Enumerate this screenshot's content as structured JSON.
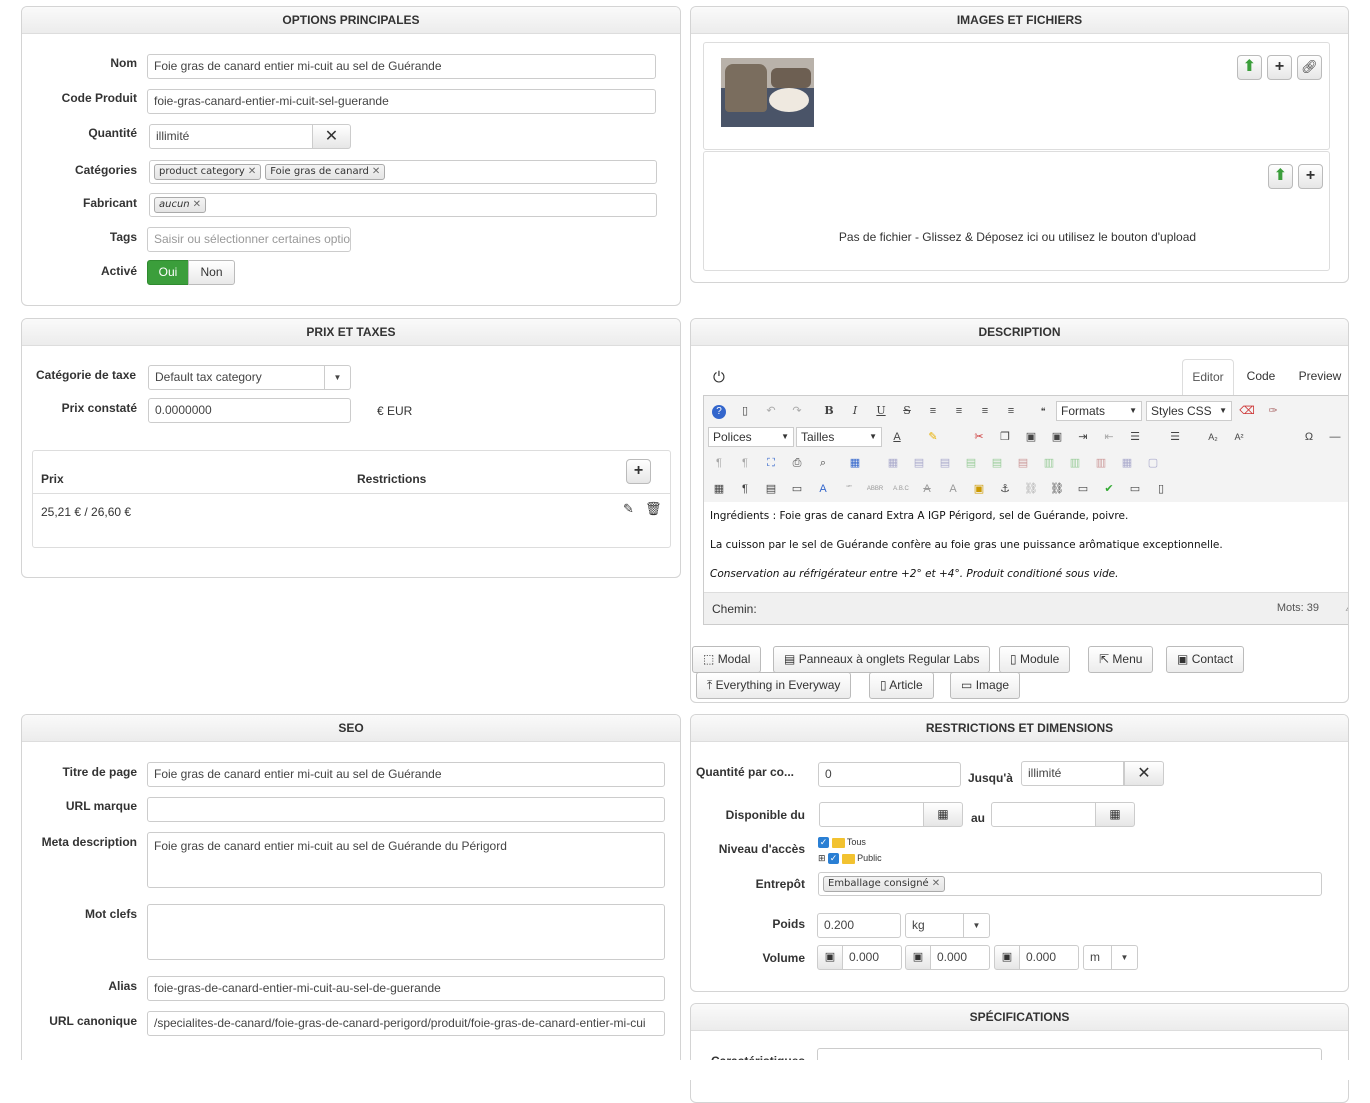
{
  "options": {
    "title": "OPTIONS PRINCIPALES",
    "nom_label": "Nom",
    "nom_value": "Foie gras de canard entier mi-cuit au sel de Guérande",
    "code_label": "Code Produit",
    "code_value": "foie-gras-canard-entier-mi-cuit-sel-guerande",
    "qty_label": "Quantité",
    "qty_value": "illimité",
    "cat_label": "Catégories",
    "categories": [
      "product category",
      "Foie gras de canard"
    ],
    "fab_label": "Fabricant",
    "fab_tag": "aucun",
    "tags_label": "Tags",
    "tags_placeholder": "Saisir ou sélectionner certaines optio",
    "active_label": "Activé",
    "yes": "Oui",
    "no": "Non"
  },
  "images": {
    "title": "IMAGES ET FICHIERS",
    "empty_text": "Pas de fichier - Glissez & Déposez ici ou utilisez le bouton d'upload"
  },
  "prix": {
    "title": "PRIX ET TAXES",
    "tax_label": "Catégorie de taxe",
    "tax_value": "Default tax category",
    "prix_label": "Prix constaté",
    "prix_value": "0.0000000",
    "currency": "€ EUR",
    "col_prix": "Prix",
    "col_restrictions": "Restrictions",
    "row_price": "25,21 € / 26,60 €"
  },
  "description": {
    "title": "DESCRIPTION",
    "tabs": [
      "Editor",
      "Code",
      "Preview"
    ],
    "formats": "Formats",
    "styles": "Styles CSS",
    "polices": "Polices",
    "tailles": "Tailles",
    "line1": "Ingrédients : Foie gras de canard Extra A IGP Périgord, sel de Guérande, poivre.",
    "line2": "La cuisson par le sel de Guérande confère au foie gras une puissance arômatique exceptionnelle.",
    "line3": "Conservation au réfrigérateur entre +2° et +4°. Produit conditioné sous vide.",
    "path": "Chemin:",
    "words": "Mots: 39",
    "buttons": [
      "Modal",
      "Panneaux à onglets Regular Labs",
      "Module",
      "Menu",
      "Contact",
      "Everything in Everyway",
      "Article",
      "Image"
    ]
  },
  "seo": {
    "title": "SEO",
    "page_title_label": "Titre de page",
    "page_title_value": "Foie gras de canard entier mi-cuit au sel de Guérande",
    "url_marque_label": "URL marque",
    "meta_label": "Meta description",
    "meta_value": "Foie gras de canard entier mi-cuit au sel de Guérande du Périgord",
    "keywords_label": "Mot clefs",
    "alias_label": "Alias",
    "alias_value": "foie-gras-de-canard-entier-mi-cuit-au-sel-de-guerande",
    "canon_label": "URL canonique",
    "canon_value": "/specialites-de-canard/foie-gras-de-canard-perigord/produit/foie-gras-de-canard-entier-mi-cui"
  },
  "restrictions": {
    "title": "RESTRICTIONS ET DIMENSIONS",
    "qty_label": "Quantité par co...",
    "qty_value": "0",
    "until_label": "Jusqu'à",
    "until_value": "illimité",
    "dispo_label": "Disponible du",
    "au_label": "au",
    "access_label": "Niveau d'accès",
    "access_tous": "Tous",
    "access_public": "Public",
    "entrepot_label": "Entrepôt",
    "entrepot_tag": "Emballage consigné",
    "poids_label": "Poids",
    "poids_value": "0.200",
    "poids_unit": "kg",
    "volume_label": "Volume",
    "vol1": "0.000",
    "vol2": "0.000",
    "vol3": "0.000",
    "vol_unit": "m"
  },
  "specs": {
    "title": "SPÉCIFICATIONS",
    "first_label": "Caractéristiques"
  },
  "colors": {
    "green": "#3b9e3b",
    "blue_check": "#2a7fd4",
    "folder": "#f2c230"
  }
}
